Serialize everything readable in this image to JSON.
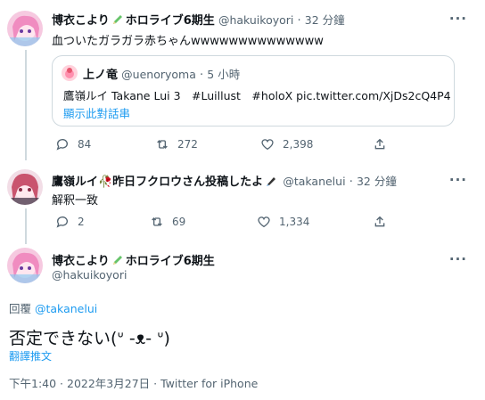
{
  "tweet1": {
    "name": "博衣こより",
    "name_suffix": "ホロライブ6期生",
    "handle": "@hakuikoyori",
    "time": "32 分鐘",
    "text": "血ついたガラガラ赤ちゃんwwwwwwwwwwwwww",
    "replies": "84",
    "retweets": "272",
    "likes": "2,398"
  },
  "quote": {
    "name": "上ノ竜",
    "handle": "@uenoryoma",
    "time": "5 小時",
    "text": "鷹嶺ルイ Takane Lui 3　#Luillust　#holoX pic.twitter.com/XjDs2cQ4P4",
    "show_thread": "顯示此對話串"
  },
  "tweet2": {
    "name": "鷹嶺ルイ🥀昨日フクロウさん投稿したよ",
    "handle": "@takanelui",
    "time": "32 分鐘",
    "text": "解釈一致",
    "replies": "2",
    "retweets": "69",
    "likes": "1,334"
  },
  "main": {
    "name": "博衣こより",
    "name_suffix": "ホロライブ6期生",
    "handle": "@hakuikoyori",
    "reply_prefix": "回覆",
    "reply_to": "@takanelui",
    "text": "否定できない(ᐡ -ᴥ- ᐡ)",
    "translate": "翻譯推文",
    "timestamp": "下午1:40 · 2022年3月27日 · Twitter for iPhone"
  },
  "colors": {
    "link": "#1d9bf0",
    "secondary": "#536471",
    "border": "#cfd9de"
  }
}
